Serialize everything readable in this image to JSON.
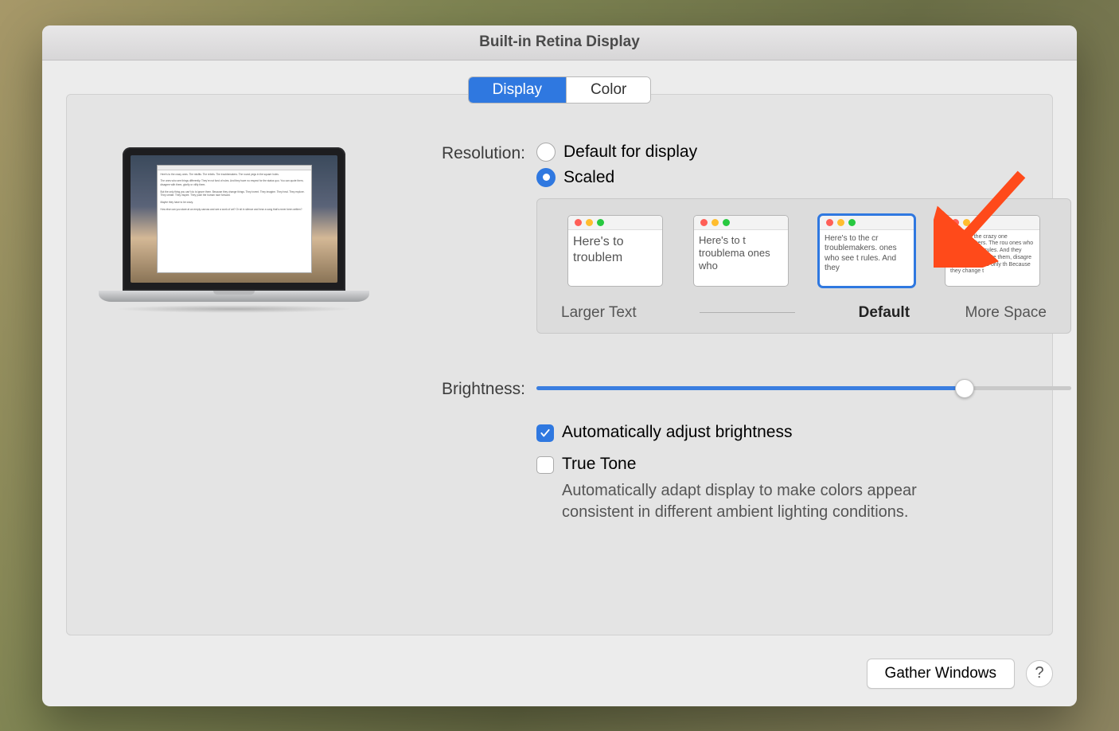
{
  "window_title": "Built-in Retina Display",
  "tabs": {
    "display": "Display",
    "color": "Color",
    "active": "display"
  },
  "resolution": {
    "label": "Resolution:",
    "default_label": "Default for display",
    "scaled_label": "Scaled",
    "selected": "scaled"
  },
  "scale_options": {
    "larger_text": "Larger Text",
    "default": "Default",
    "more_space": "More Space",
    "selected_index": 2,
    "preview_text": {
      "t1": "Here's to troublem",
      "t2": "Here's to t troublema ones who",
      "t3": "Here's to the cr troublemakers. ones who see t rules. And they",
      "t4": "Here's to the crazy one troublemakers. The rou ones who see things dif rules. And they have no can quote them, disagre them. About the only th Because they change t"
    }
  },
  "brightness": {
    "label": "Brightness:",
    "value_percent": 80,
    "auto_label": "Automatically adjust brightness",
    "auto_checked": true,
    "truetone_label": "True Tone",
    "truetone_checked": false,
    "truetone_desc": "Automatically adapt display to make colors appear consistent in different ambient lighting conditions."
  },
  "footer": {
    "gather": "Gather Windows",
    "help": "?"
  },
  "colors": {
    "accent": "#2f78e0",
    "arrow": "#ff4a1a"
  }
}
